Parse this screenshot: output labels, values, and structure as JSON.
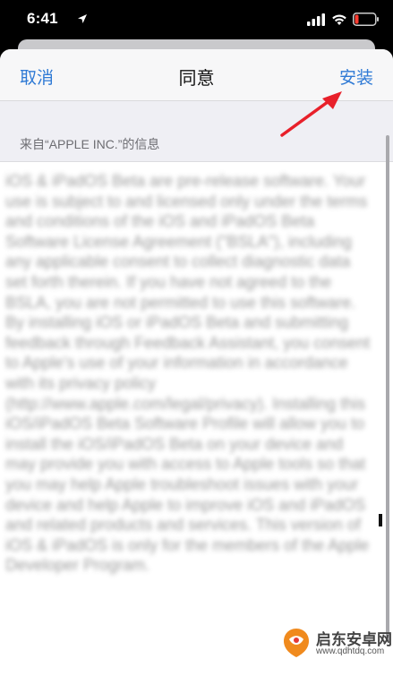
{
  "status": {
    "time": "6:41"
  },
  "navbar": {
    "cancel_label": "取消",
    "title": "同意",
    "install_label": "安装"
  },
  "section": {
    "label": "来自“APPLE INC.”的信息"
  },
  "agreement": {
    "text": "iOS & iPadOS Beta are pre-release software. Your use is subject to and licensed only under the terms and conditions of the iOS and iPadOS Beta Software License Agreement (\"BSLA\"), including any applicable consent to collect diagnostic data set forth therein. If you have not agreed to the BSLA, you are not permitted to use this software. By installing iOS or iPadOS Beta and submitting feedback through Feedback Assistant, you consent to Apple's use of your information in accordance with its privacy policy (http://www.apple.com/legal/privacy). Installing this iOS/iPadOS Beta Software Profile will allow you to install the iOS/iPadOS Beta on your device and may provide you with access to Apple tools so that you may help Apple troubleshoot issues with your device and help Apple to improve iOS and iPadOS and related products and services. This version of iOS & iPadOS is only for the members of the Apple Developer Program."
  },
  "watermark": {
    "name": "启东安卓网",
    "url": "www.qdhtdq.com"
  },
  "colors": {
    "accent": "#2f7ad5",
    "annotation": "#e8202a"
  }
}
